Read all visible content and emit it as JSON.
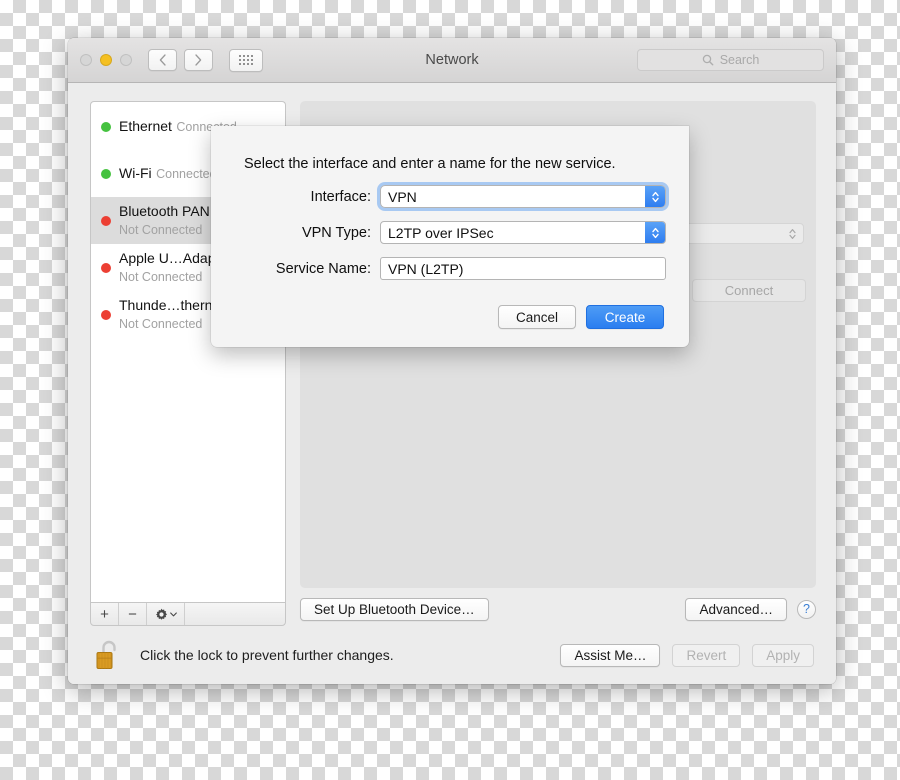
{
  "window": {
    "title": "Network",
    "traffic_lights": [
      "close-button",
      "minimize-button",
      "zoom-button"
    ],
    "nav": {
      "back_label": "‹",
      "forward_label": "›",
      "grid_label": "show-all-grid"
    },
    "search": {
      "placeholder": "Search",
      "value": "",
      "icon": "search-icon"
    }
  },
  "sidebar": {
    "services": [
      {
        "name": "Ethernet",
        "status": "Connected",
        "state": "green",
        "selected": false,
        "has_link_icon": false
      },
      {
        "name": "Wi-Fi",
        "status": "Connected",
        "state": "green",
        "selected": false,
        "has_link_icon": false
      },
      {
        "name": "Bluetooth PAN",
        "status": "Not Connected",
        "state": "red",
        "selected": true,
        "has_link_icon": false
      },
      {
        "name": "Apple U…Adapter",
        "status": "Not Connected",
        "state": "red",
        "selected": false,
        "has_link_icon": true
      },
      {
        "name": "Thunde…thernet",
        "status": "Not Connected",
        "state": "red",
        "selected": false,
        "has_link_icon": true
      }
    ],
    "toolbar": {
      "add_label": "+",
      "remove_label": "−",
      "gear_label": "action-gear",
      "gear_chevron": "⌄"
    }
  },
  "main_pane": {
    "connect_label": "Connect",
    "setup_button": "Set Up Bluetooth Device…",
    "advanced_button": "Advanced…",
    "help_button": "?"
  },
  "bottom_bar": {
    "lock_icon": "unlocked-padlock-icon",
    "lock_text": "Click the lock to prevent further changes.",
    "assist_button": "Assist Me…",
    "revert_button": "Revert",
    "apply_button": "Apply",
    "revert_disabled": true,
    "apply_disabled": true
  },
  "sheet": {
    "prompt": "Select the interface and enter a name for the new service.",
    "fields": {
      "interface_label": "Interface:",
      "interface_value": "VPN",
      "vpn_type_label": "VPN Type:",
      "vpn_type_value": "L2TP over IPSec",
      "service_name_label": "Service Name:",
      "service_name_value": "VPN (L2TP)"
    },
    "cancel_button": "Cancel",
    "create_button": "Create"
  },
  "colors": {
    "accent_blue": "#2b7ef0",
    "status_connected": "#45c23f",
    "status_not_connected": "#ec3f33",
    "window_chrome": "#ececec",
    "sheet_bg": "#f4f4f4"
  }
}
